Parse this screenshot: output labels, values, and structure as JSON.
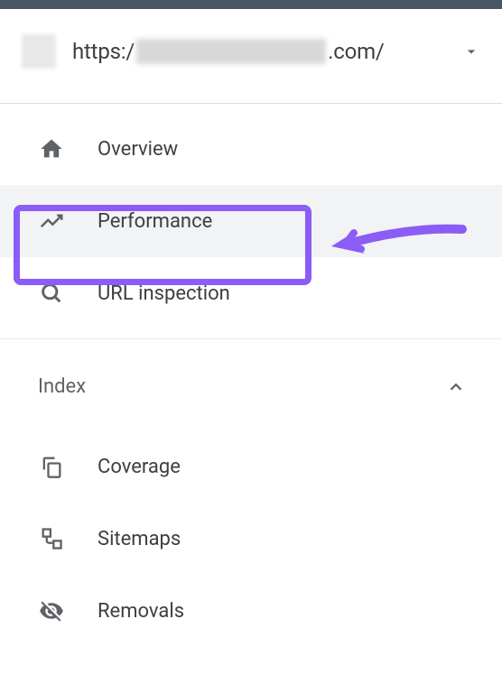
{
  "property": {
    "url_prefix": "https:/",
    "url_suffix": ".com/"
  },
  "nav": {
    "overview": "Overview",
    "performance": "Performance",
    "url_inspection": "URL inspection"
  },
  "index_section": {
    "title": "Index",
    "coverage": "Coverage",
    "sitemaps": "Sitemaps",
    "removals": "Removals"
  }
}
